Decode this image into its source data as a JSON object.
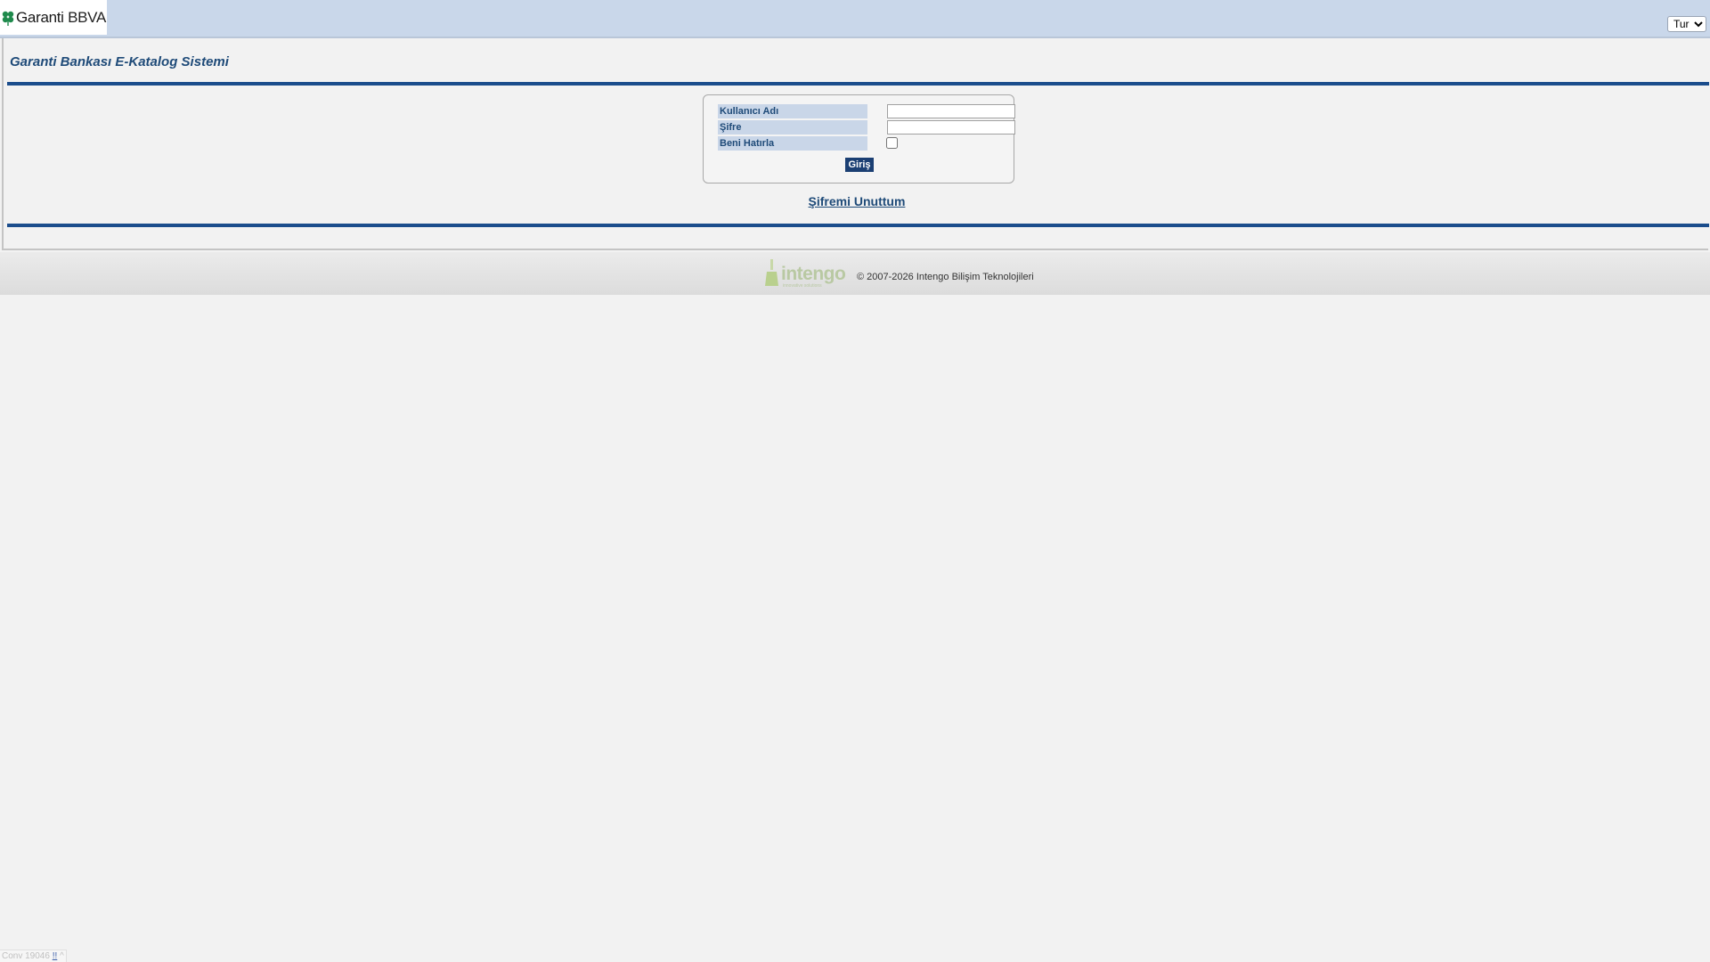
{
  "header": {
    "brand": "Garanti",
    "brand_suffix": "BBVA",
    "language_select": {
      "selected": "Tur",
      "options": [
        "Tur"
      ]
    }
  },
  "main": {
    "title": "Garanti Bankası E-Katalog Sistemi",
    "login": {
      "username_label": "Kullanıcı Adı",
      "username_value": "",
      "password_label": "Şifre",
      "password_value": "",
      "remember_label": "Beni Hatırla",
      "remember_checked": false,
      "submit_label": "Giriş"
    },
    "forgot_password": "Şifremi Unuttum"
  },
  "footer": {
    "company_logo": "intengo",
    "company_tagline": "innovative solutions",
    "copyright": "© 2007-2026 Intengo Bilişim Teknolojileri"
  },
  "version": {
    "text": "Conv 19046",
    "link1": "!!",
    "link2": "^"
  },
  "colors": {
    "accent": "#1b4d8c",
    "header_bg": "#c9d7ea",
    "label_bg": "#c9d6e8",
    "button_bg": "#1b3f73"
  }
}
